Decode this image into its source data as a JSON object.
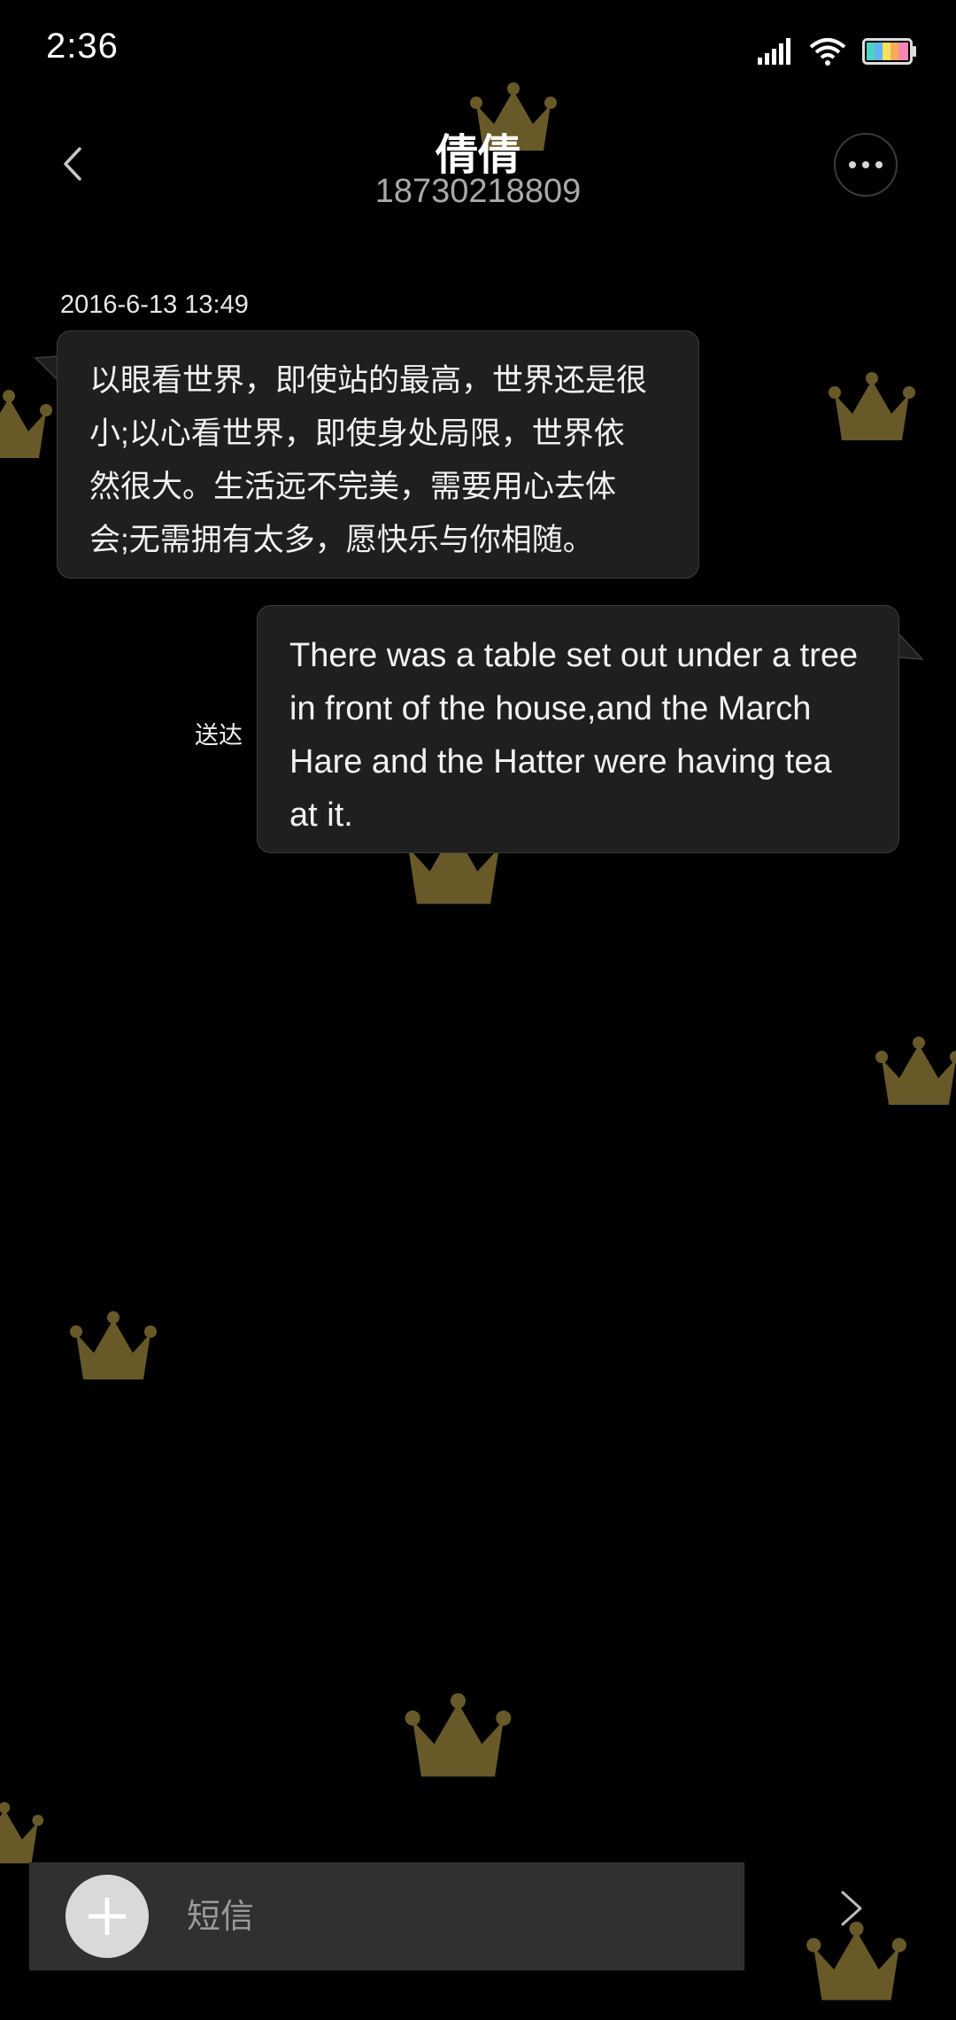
{
  "status_bar": {
    "time": "2:36",
    "icons": [
      "signal-icon",
      "wifi-icon",
      "battery-icon"
    ]
  },
  "header": {
    "contact_name": "倩倩",
    "contact_number": "18730218809",
    "back_icon": "chevron-left-icon",
    "more_icon": "more-horizontal-icon"
  },
  "conversation": {
    "timestamp": "2016-6-13 13:49",
    "messages": [
      {
        "direction": "incoming",
        "lines": [
          "以眼看世界，即使站的最高，世界还是很",
          "小;以心看世界，即使身处局限，世界依",
          "然很大。生活远不完美，需要用心去体",
          "会;无需拥有太多，愿快乐与你相随。"
        ]
      },
      {
        "direction": "outgoing",
        "status": "送达",
        "lines": [
          "There was a table set out under a tree",
          "in front of the house,and the March",
          "Hare and the Hatter were having tea",
          "at it."
        ]
      }
    ]
  },
  "composer": {
    "placeholder": "短信",
    "add_icon": "plus-icon",
    "send_icon": "chevron-right-icon"
  },
  "colors": {
    "background": "#000000",
    "bubble": "#1f1f1f",
    "crown": "#7a6a2f"
  }
}
